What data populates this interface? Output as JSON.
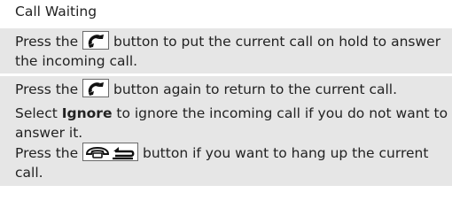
{
  "title": "Call Waiting",
  "step1": {
    "before": "Press the ",
    "after": " button to put the current call on hold to answer the incoming call."
  },
  "step2": {
    "before": "Press the ",
    "after": " button again to return to the current call."
  },
  "step3": {
    "before": "Select ",
    "bold": "Ignore",
    "after": " to ignore the incoming call if you do not want to answer it."
  },
  "step4": {
    "before": "Press the ",
    "after": " button if you want to hang up the current call."
  },
  "icons": {
    "pickup": "phone-pickup-icon",
    "hangup": "hangup-back-icon"
  }
}
